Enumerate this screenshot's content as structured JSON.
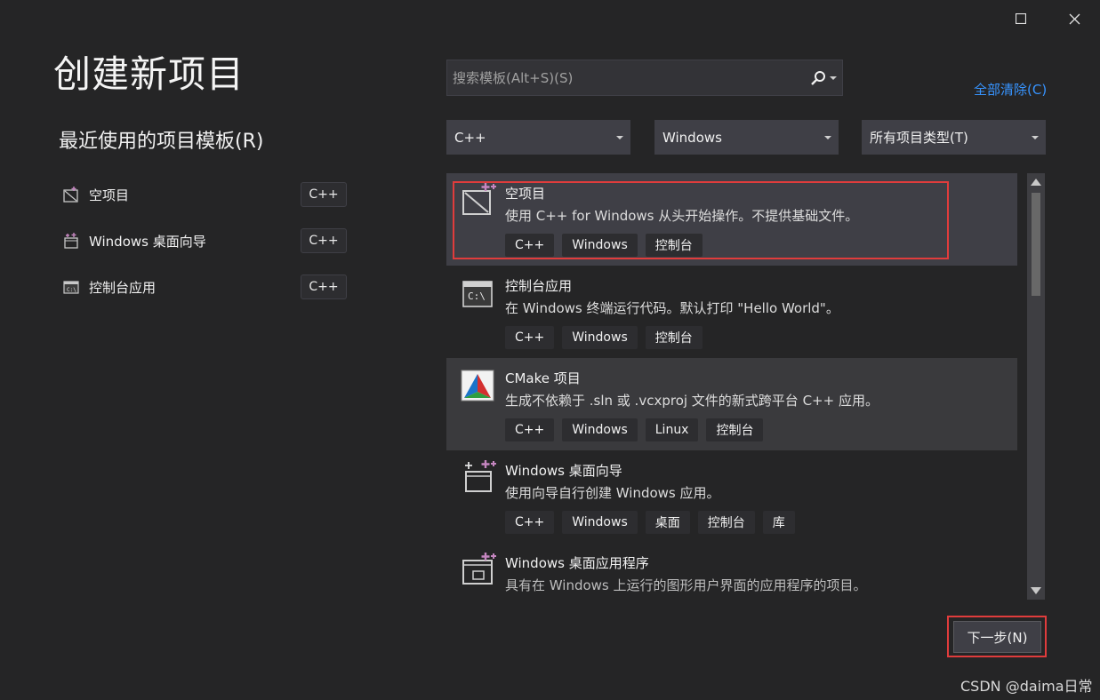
{
  "window": {
    "maximize_icon": "maximize-icon",
    "close_icon": "close-icon"
  },
  "page_title": "创建新项目",
  "recent": {
    "title": "最近使用的项目模板(R)",
    "items": [
      {
        "label": "空项目",
        "lang": "C++",
        "icon": "empty-project-icon"
      },
      {
        "label": "Windows 桌面向导",
        "lang": "C++",
        "icon": "windows-wizard-icon"
      },
      {
        "label": "控制台应用",
        "lang": "C++",
        "icon": "console-app-icon"
      }
    ]
  },
  "search": {
    "placeholder": "搜索模板(Alt+S)(S)",
    "icon": "search-icon"
  },
  "clear_all": "全部清除(C)",
  "filters": {
    "language": "C++",
    "platform": "Windows",
    "project_type": "所有项目类型(T)"
  },
  "templates": [
    {
      "name": "空项目",
      "desc": "使用 C++ for Windows 从头开始操作。不提供基础文件。",
      "tags": [
        "C++",
        "Windows",
        "控制台"
      ],
      "icon": "empty-project-icon"
    },
    {
      "name": "控制台应用",
      "desc": "在 Windows 终端运行代码。默认打印 \"Hello World\"。",
      "tags": [
        "C++",
        "Windows",
        "控制台"
      ],
      "icon": "console-app-icon"
    },
    {
      "name": "CMake 项目",
      "desc": "生成不依赖于 .sln 或 .vcxproj 文件的新式跨平台 C++ 应用。",
      "tags": [
        "C++",
        "Windows",
        "Linux",
        "控制台"
      ],
      "icon": "cmake-icon"
    },
    {
      "name": "Windows 桌面向导",
      "desc": "使用向导自行创建 Windows 应用。",
      "tags": [
        "C++",
        "Windows",
        "桌面",
        "控制台",
        "库"
      ],
      "icon": "windows-wizard-icon"
    },
    {
      "name": "Windows 桌面应用程序",
      "desc": "具有在 Windows 上运行的图形用户界面的应用程序的项目。",
      "tags": [],
      "icon": "desktop-app-icon"
    }
  ],
  "next_button": "下一步(N)",
  "watermark": "CSDN @daima日常"
}
